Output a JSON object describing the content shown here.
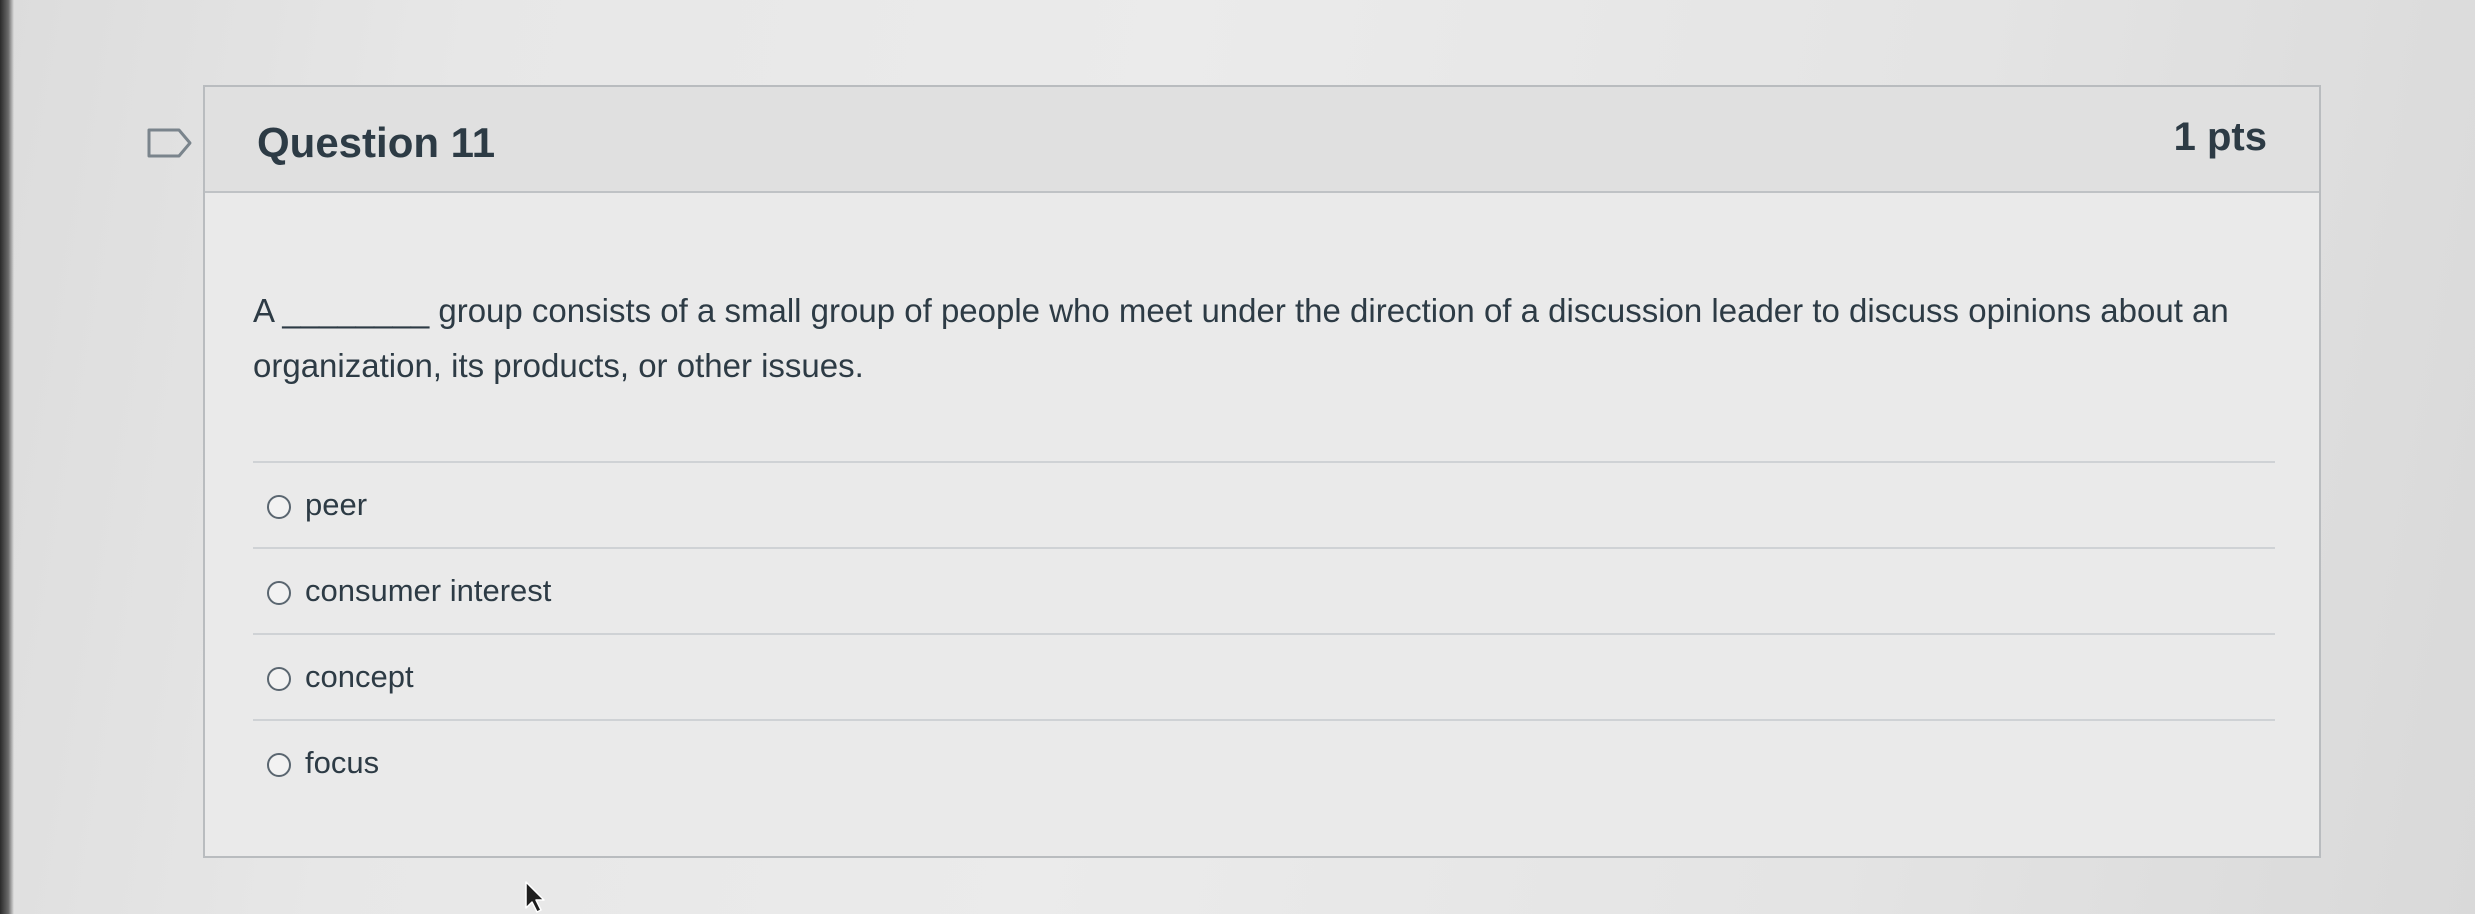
{
  "question": {
    "title": "Question 11",
    "points": "1 pts",
    "text": "A ________ group consists of a small group of people who meet under the direction of a discussion leader to discuss opinions about an organization, its products, or other issues.",
    "answers": [
      {
        "label": "peer",
        "selected": false
      },
      {
        "label": "consumer interest",
        "selected": false
      },
      {
        "label": "concept",
        "selected": false
      },
      {
        "label": "focus",
        "selected": false
      }
    ]
  },
  "icons": {
    "flag": "flag-question-icon",
    "cursor": "mouse-pointer-icon",
    "radio": "radio-unchecked-icon"
  },
  "colors": {
    "text": "#2d3b45",
    "border": "#b9bcbf",
    "header_bg": "#e0e0e0"
  }
}
